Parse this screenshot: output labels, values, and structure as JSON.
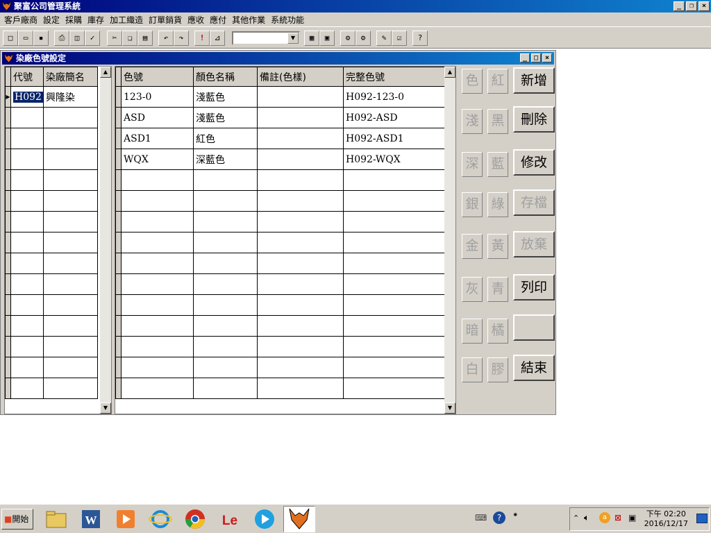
{
  "window": {
    "title": "聚富公司管理系統"
  },
  "menu": [
    "客戶廠商",
    "設定",
    "採購",
    "庫存",
    "加工織造",
    "訂單銷貨",
    "應收",
    "應付",
    "其他作業",
    "系統功能"
  ],
  "child": {
    "title": "染廠色號設定"
  },
  "left_grid": {
    "headers": [
      "代號",
      "染廠簡名"
    ],
    "rows": [
      [
        "H092",
        "興隆染"
      ]
    ]
  },
  "right_grid": {
    "headers": [
      "色號",
      "顏色名稱",
      "備註(色樣)",
      "完整色號"
    ],
    "rows": [
      [
        "123-0",
        "淺藍色",
        "",
        "H092-123-0"
      ],
      [
        "ASD",
        "淺藍色",
        "",
        "H092-ASD"
      ],
      [
        "ASD1",
        "紅色",
        "",
        "H092-ASD1"
      ],
      [
        "WQX",
        "深藍色",
        "",
        "H092-WQX"
      ]
    ]
  },
  "color_buttons": {
    "col1": [
      "色",
      "淺",
      "深",
      "銀",
      "金",
      "灰",
      "暗",
      "白"
    ],
    "col2": [
      "紅",
      "黑",
      "藍",
      "綠",
      "黃",
      "青",
      "橘",
      "膠"
    ]
  },
  "actions": {
    "add": "新增",
    "delete": "刪除",
    "edit": "修改",
    "save": "存檔",
    "discard": "放棄",
    "print": "列印",
    "blank": "",
    "exit": "結束"
  },
  "taskbar": {
    "start_label": "開始",
    "clock_time": "下午 02:20",
    "clock_date": "2016/12/17"
  },
  "colors": {
    "titlebar": "#00007b",
    "face": "#d4d0c8",
    "selection": "#0a246a"
  }
}
